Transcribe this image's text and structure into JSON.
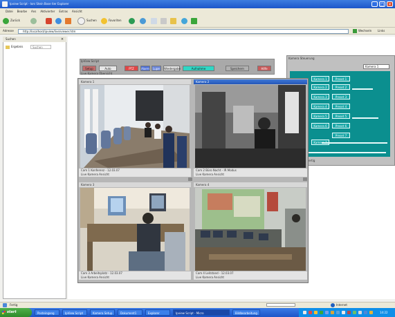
{
  "window": {
    "title": "Ipview Script - Iors Stein Bose tier Explorer",
    "controls": {
      "minimize": "_",
      "maximize": "□",
      "close": "×"
    }
  },
  "menubar": [
    "Datei",
    "Bearbe",
    "Ans",
    "Aktivierter",
    "Extras",
    "Ansicht"
  ],
  "toolbar": {
    "back": "Zurück",
    "search": "Suchen",
    "favorites": "Favoriten"
  },
  "addressbar": {
    "label": "Adresse",
    "url": "http://localhost/ipview/live/viewer.htm",
    "go": "Wechseln",
    "links": "Links"
  },
  "sidebar": {
    "title": "Suchen",
    "close": "×",
    "item": "Ergebnis",
    "search_placeholder": "Suchen"
  },
  "cam_toolbar": {
    "title": "IpView Script",
    "buttons": [
      "Setup",
      "Auto",
      "PTZ",
      "Alarm",
      "Lupe",
      "Wiedergabe",
      "Aufnahme",
      "Speichern",
      "Hilfe"
    ],
    "status": "Live Kamera Übersicht"
  },
  "panel": {
    "title": "Kamera Steuerung",
    "field": "Kamera 1",
    "buttons_left": [
      "Kamera 1",
      "Kamera 2",
      "Kamera 3",
      "Kamera 4",
      "Kamera 5",
      "Kamera 6",
      "Kamera 7"
    ],
    "buttons_right": [
      "Preset 1",
      "Preset 2",
      "Preset 3",
      "Preset 4",
      "Preset 5",
      "Preset 6",
      "Preset 7"
    ],
    "footer": "Fertig"
  },
  "cameras": [
    {
      "header": "Kamera 1",
      "line1": "Cam 1 Konferenz - 12.03.07",
      "line2": "Live Kamera Ansicht"
    },
    {
      "header": "Kamera 2",
      "line1": "Cam 2 Büro Nacht - IR Modus",
      "line2": "Live Kamera Ansicht"
    },
    {
      "header": "Kamera 3",
      "line1": "Cam 3 Arbeitsplatz - 12.03.07",
      "line2": "Live Kamera Ansicht"
    },
    {
      "header": "Kamera 4",
      "line1": "Cam 4 Leitstand - 12.03.07",
      "line2": "Live Kamera Ansicht"
    }
  ],
  "statusbar": {
    "text": "Fertig",
    "zone": "Internet",
    "progress": 0
  },
  "taskbar": {
    "start": "start",
    "tasks": [
      "Posteingang",
      "IpView Script",
      "Kamera Setup",
      "Dokument1",
      "Explorer",
      "Ipview Script - Micro",
      "Bildbearbeitung"
    ],
    "clock": "14:22"
  },
  "colors": {
    "accent": "#1c56c9",
    "panel_teal": "#0b8f8f",
    "start_green": "#2f8b2b"
  }
}
